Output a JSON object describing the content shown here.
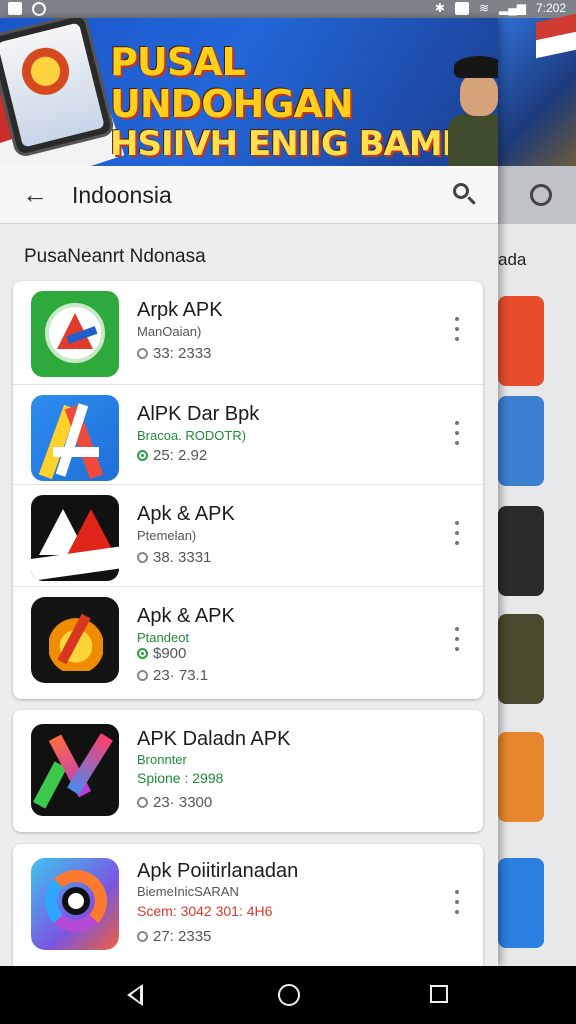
{
  "status": {
    "time": "7:202"
  },
  "banner": {
    "line1": "PUSAL UNDOHGAN",
    "line2": "HSIIVH ENIIG BAMI"
  },
  "appbar": {
    "title": "Indoonsia"
  },
  "section": {
    "title": "PusaNeanrt Ndonasa"
  },
  "background": {
    "subtitle_fragment": "ada"
  },
  "apps": [
    {
      "name": "Arpk APK",
      "sub": "ManOaian)",
      "sub_color": "#555555",
      "stats": [
        {
          "text": "33: 2333",
          "dot": "grey"
        }
      ]
    },
    {
      "name": "AlPK Dar Bpk",
      "sub": "Bracoa. RODOTR)",
      "sub_color": "#1f8a3a",
      "stats": [
        {
          "text": "25: 2.92",
          "dot": "green"
        }
      ]
    },
    {
      "name": "Apk & APK",
      "sub": "Ptemelan)",
      "sub_color": "#555555",
      "stats": [
        {
          "text": "38. 3331",
          "dot": "grey"
        }
      ]
    },
    {
      "name": "Apk & APK",
      "sub": "Ptandeot",
      "sub_color": "#1f8a3a",
      "stats": [
        {
          "text": "$900",
          "dot": "green"
        },
        {
          "text": "23· 73.1",
          "dot": "grey"
        }
      ]
    },
    {
      "name": "APK Daladn APK",
      "sub": "Bronnter",
      "sub_color": "#1f8a3a",
      "sub2": "Spione : 2998",
      "sub2_color": "#1f8a3a",
      "stats": [
        {
          "text": "23· 3300",
          "dot": "grey"
        }
      ]
    },
    {
      "name": "Apk Poiitirlanadan",
      "sub": "BiemeInicSARAN",
      "sub_color": "#555555",
      "sub2": "Scem: 3042 301: 4H6",
      "sub2_color": "#d23b2f",
      "stats": [
        {
          "text": "27: 2335",
          "dot": "grey"
        }
      ]
    }
  ],
  "colors": {
    "accent_green": "#2ea043",
    "alert_red": "#d23b2f",
    "banner_blue": "#1b56c9",
    "banner_text": "#ffcf1a"
  }
}
